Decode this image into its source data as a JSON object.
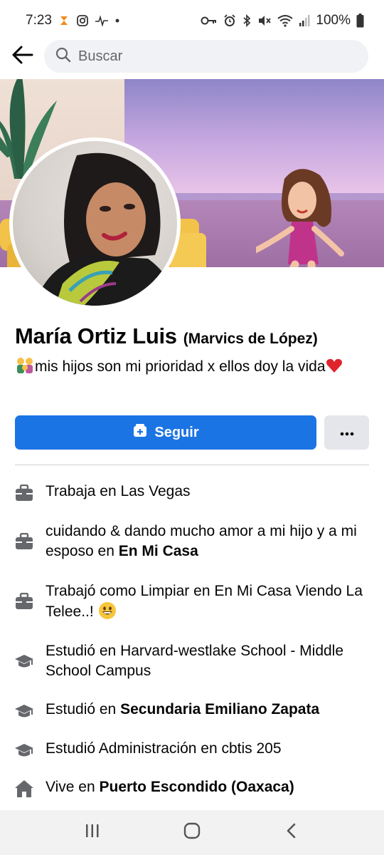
{
  "status_bar": {
    "time": "7:23",
    "battery": "100%",
    "icons": [
      "heart-app-icon",
      "instagram-icon",
      "pulse-icon",
      "dot-icon",
      "key-icon",
      "alarm-icon",
      "bluetooth-icon",
      "mute-icon",
      "wifi-icon",
      "signal-icon",
      "battery-icon"
    ]
  },
  "search": {
    "placeholder": "Buscar",
    "value": ""
  },
  "profile": {
    "name": "María Ortiz Luis",
    "alternate_name": "(Marvics de López)",
    "bio_text": "mis hijos son mi prioridad x ellos doy la vida",
    "bio_emojis": [
      "family-emoji",
      "red-heart-emoji"
    ]
  },
  "actions": {
    "follow_label": "Seguir",
    "more_label": "···"
  },
  "details": [
    {
      "icon": "briefcase-icon",
      "parts": [
        {
          "text": "Trabaja en Las Vegas",
          "bold": false
        }
      ]
    },
    {
      "icon": "briefcase-icon",
      "parts": [
        {
          "text": "cuidando & dando mucho amor a mi hijo y a mi esposo en ",
          "bold": false
        },
        {
          "text": "En Mi Casa",
          "bold": true
        }
      ]
    },
    {
      "icon": "briefcase-icon",
      "parts": [
        {
          "text": "Trabajó como Limpiar en En Mi Casa Viendo La Telee..! ",
          "bold": false
        }
      ],
      "emoji": "grinning-face-emoji"
    },
    {
      "icon": "graduation-cap-icon",
      "parts": [
        {
          "text": "Estudió en Harvard-westlake School - Middle School Campus",
          "bold": false
        }
      ]
    },
    {
      "icon": "graduation-cap-icon",
      "parts": [
        {
          "text": "Estudió en ",
          "bold": false
        },
        {
          "text": "Secundaria Emiliano Zapata",
          "bold": true
        }
      ]
    },
    {
      "icon": "graduation-cap-icon",
      "parts": [
        {
          "text": "Estudió Administración en cbtis 205",
          "bold": false
        }
      ]
    },
    {
      "icon": "home-icon",
      "parts": [
        {
          "text": "Vive en ",
          "bold": false
        },
        {
          "text": "Puerto Escondido (Oaxaca)",
          "bold": true
        }
      ]
    }
  ],
  "nav": {
    "icons": [
      "recent-apps-icon",
      "home-circle-icon",
      "back-chevron-icon"
    ]
  },
  "colors": {
    "primary": "#1b74e4",
    "secondary_button": "#e4e6eb",
    "search_bg": "#f0f2f5",
    "text": "#050505",
    "muted": "#65676b",
    "icon": "#606770"
  }
}
